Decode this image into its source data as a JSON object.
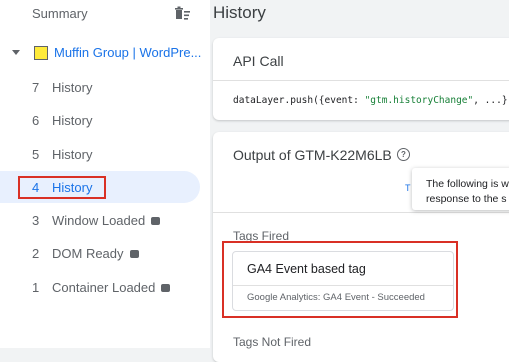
{
  "sidebar": {
    "summary_label": "Summary",
    "group_label": "Muffin Group | WordPre...",
    "items": [
      {
        "num": "7",
        "label": "History"
      },
      {
        "num": "6",
        "label": "History"
      },
      {
        "num": "5",
        "label": "History"
      },
      {
        "num": "4",
        "label": "History"
      },
      {
        "num": "3",
        "label": "Window Loaded"
      },
      {
        "num": "2",
        "label": "DOM Ready"
      },
      {
        "num": "1",
        "label": "Container Loaded"
      }
    ]
  },
  "main": {
    "title": "History",
    "api_card": {
      "title": "API Call",
      "code_prefix": "dataLayer.push({event: ",
      "code_string": "\"gtm.historyChange\"",
      "code_suffix": ", ...})"
    },
    "output_card": {
      "title": "Output of GTM-K22M6LB",
      "tab_fragment": "T",
      "tags_fired_label": "Tags Fired",
      "tag": {
        "name": "GA4 Event based tag",
        "status": "Google Analytics: GA4 Event - Succeeded"
      },
      "tags_not_fired_label": "Tags Not Fired"
    },
    "tooltip": {
      "line1": "The following is w",
      "line2": "response to the s"
    }
  },
  "colors": {
    "accent": "#1a73e8",
    "highlight": "#d93025",
    "folder": "#ffeb3b"
  }
}
